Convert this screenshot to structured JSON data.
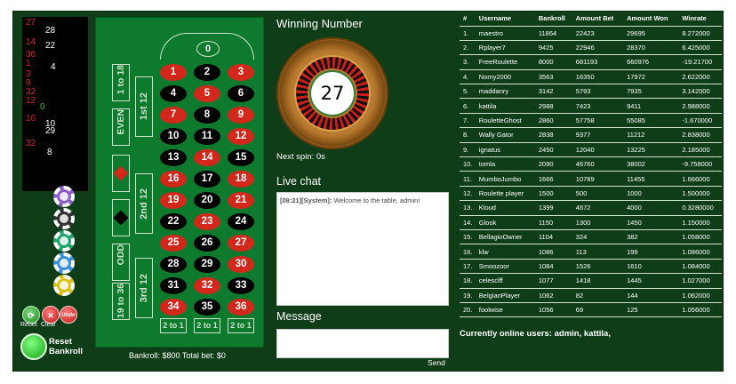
{
  "history": [
    {
      "v": "27",
      "c": "red"
    },
    {
      "v": "28",
      "c": "white"
    },
    {
      "v": "14",
      "c": "red"
    },
    {
      "v": "22",
      "c": "white"
    },
    {
      "v": "36",
      "c": "red"
    },
    {
      "v": "1",
      "c": "red"
    },
    {
      "v": "4",
      "c": "white"
    },
    {
      "v": "3",
      "c": "red"
    },
    {
      "v": "9",
      "c": "red"
    },
    {
      "v": "32",
      "c": "red"
    },
    {
      "v": "12",
      "c": "red"
    },
    {
      "v": "0",
      "c": "green"
    },
    {
      "v": "16",
      "c": "red"
    },
    {
      "v": "10",
      "c": "white"
    },
    {
      "v": "29",
      "c": "white"
    },
    {
      "v": "32",
      "c": "red"
    },
    {
      "v": "8",
      "c": "white"
    }
  ],
  "chips": [
    "#8a5cc6",
    "#333333",
    "#1fa36a",
    "#3a8fd8",
    "#d8c21a"
  ],
  "controls": {
    "rebet": "Rebet",
    "clear": "Clear",
    "undo": "Undo",
    "reset": "Reset Bankroll"
  },
  "table": {
    "zero": "0",
    "numbers": [
      [
        "1",
        "r"
      ],
      [
        "2",
        "b"
      ],
      [
        "3",
        "r"
      ],
      [
        "4",
        "b"
      ],
      [
        "5",
        "r"
      ],
      [
        "6",
        "b"
      ],
      [
        "7",
        "r"
      ],
      [
        "8",
        "b"
      ],
      [
        "9",
        "r"
      ],
      [
        "10",
        "b"
      ],
      [
        "11",
        "b"
      ],
      [
        "12",
        "r"
      ],
      [
        "13",
        "b"
      ],
      [
        "14",
        "r"
      ],
      [
        "15",
        "b"
      ],
      [
        "16",
        "r"
      ],
      [
        "17",
        "b"
      ],
      [
        "18",
        "r"
      ],
      [
        "19",
        "r"
      ],
      [
        "20",
        "b"
      ],
      [
        "21",
        "r"
      ],
      [
        "22",
        "b"
      ],
      [
        "23",
        "r"
      ],
      [
        "24",
        "b"
      ],
      [
        "25",
        "r"
      ],
      [
        "26",
        "b"
      ],
      [
        "27",
        "r"
      ],
      [
        "28",
        "b"
      ],
      [
        "29",
        "b"
      ],
      [
        "30",
        "r"
      ],
      [
        "31",
        "b"
      ],
      [
        "32",
        "r"
      ],
      [
        "33",
        "b"
      ],
      [
        "34",
        "r"
      ],
      [
        "35",
        "b"
      ],
      [
        "36",
        "r"
      ]
    ],
    "outside": {
      "low": "1 to 18",
      "even": "EVEN",
      "odd": "ODD",
      "high": "19 to 36"
    },
    "dozens": [
      "1st 12",
      "2nd 12",
      "3rd 12"
    ],
    "columns": [
      "2 to 1",
      "2 to 1",
      "2 to 1"
    ]
  },
  "winning": {
    "title": "Winning Number",
    "number": "27",
    "next_spin": "Next spin: 0s"
  },
  "chat": {
    "title": "Live chat",
    "time": "[08:21][System]:",
    "message": " Welcome to the table, admin!"
  },
  "message": {
    "title": "Message",
    "send": "Send"
  },
  "bankroll_line": "Bankroll: $800 Total bet: $0",
  "leaderboard": {
    "headers": [
      "#",
      "Username",
      "Bankroll",
      "Amount Bet",
      "Amount Won",
      "Winrate"
    ],
    "rows": [
      [
        "1.",
        "maestro",
        "11864",
        "22423",
        "29695",
        "8.272000"
      ],
      [
        "2.",
        "Rplayer7",
        "9425",
        "22946",
        "28370",
        "6.425000"
      ],
      [
        "3.",
        "FreeRoulette",
        "8000",
        "681193",
        "660976",
        "-19.21700"
      ],
      [
        "4.",
        "Nomy2000",
        "3563",
        "16350",
        "17972",
        "2.622000"
      ],
      [
        "5.",
        "maddanry",
        "3142",
        "5793",
        "7935",
        "3.142000"
      ],
      [
        "6.",
        "kattila",
        "2988",
        "7423",
        "9411",
        "2.988000"
      ],
      [
        "7.",
        "RouletteGhost",
        "2860",
        "57758",
        "55085",
        "-1.670000"
      ],
      [
        "8.",
        "Wally Gator",
        "2838",
        "9377",
        "11212",
        "2.838000"
      ],
      [
        "9.",
        "ignatus",
        "2450",
        "12040",
        "13225",
        "2.185000"
      ],
      [
        "10.",
        "tomla",
        "2090",
        "46760",
        "38002",
        "-9.758000"
      ],
      [
        "11.",
        "MumboJumbo",
        "1666",
        "10789",
        "11455",
        "1.666000"
      ],
      [
        "12.",
        "Roulette player",
        "1500",
        "500",
        "1000",
        "1.500000"
      ],
      [
        "13.",
        "Kloud",
        "1399",
        "4672",
        "4000",
        "0.3280000"
      ],
      [
        "14.",
        "Glook",
        "1150",
        "1300",
        "1450",
        "1.150000"
      ],
      [
        "15.",
        "BellagioOwner",
        "1104",
        "324",
        "382",
        "1.058000"
      ],
      [
        "16.",
        "klw",
        "1086",
        "113",
        "199",
        "1.086000"
      ],
      [
        "17.",
        "Smoozoor",
        "1084",
        "1526",
        "1610",
        "1.084000"
      ],
      [
        "18.",
        "celesclff",
        "1077",
        "1418",
        "1445",
        "1.027000"
      ],
      [
        "19.",
        "BelgianPlayer",
        "1062",
        "82",
        "144",
        "1.062000"
      ],
      [
        "20.",
        "foolwise",
        "1056",
        "69",
        "125",
        "1.056000"
      ]
    ]
  },
  "online": "Currently online users: admin, kattila,"
}
